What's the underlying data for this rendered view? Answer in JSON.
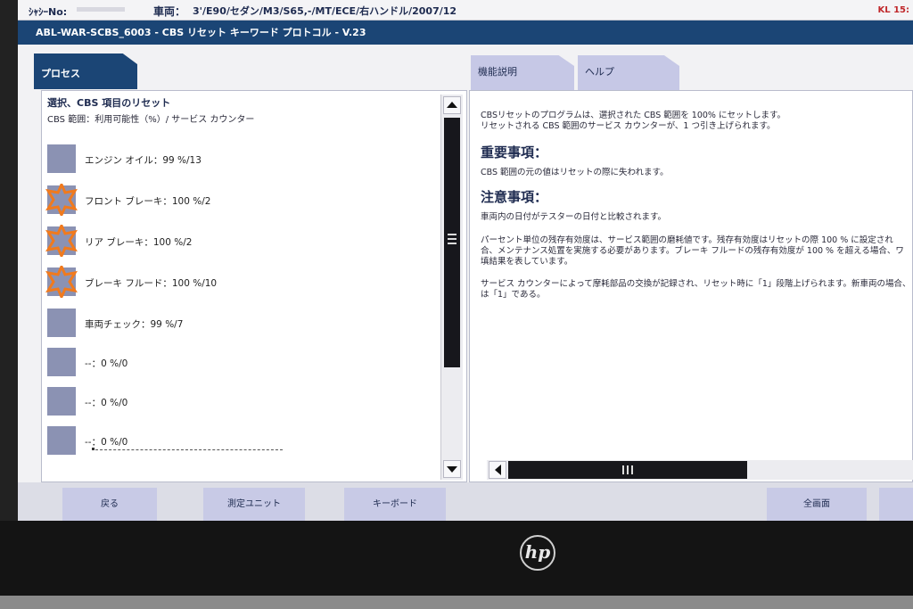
{
  "topbar": {
    "vin_label": "ｼｬｼｰNo:",
    "vehicle_label": "車両：",
    "vehicle_value": "3'/E90/セダン/M3/S65,-/MT/ECE/右ハンドル/2007/12",
    "terminal": "KL 15:"
  },
  "title": "ABL-WAR-SCBS_6003 - CBS リセット キーワード プロトコル - V.23",
  "tabs": {
    "process": "プロセス",
    "function": "機能説明",
    "help": "ヘルプ"
  },
  "left": {
    "heading": "選択、CBS 項目のリセット",
    "subheading": "CBS 範囲：利用可能性（%）/ サービス カウンター",
    "items": [
      {
        "label": "エンジン オイル：99 %/13",
        "icon": "blue-square"
      },
      {
        "label": "フロント ブレーキ：100 %/2",
        "icon": "orange-star"
      },
      {
        "label": "リア ブレーキ：100 %/2",
        "icon": "orange-star"
      },
      {
        "label": "ブレーキ フルード：100 %/10",
        "icon": "orange-star"
      },
      {
        "label": "車両チェック：99 %/7",
        "icon": "blue-square"
      },
      {
        "label": "--：0 %/0",
        "icon": "blue-square"
      },
      {
        "label": "--：0 %/0",
        "icon": "blue-square"
      },
      {
        "label": "--：0 %/0",
        "icon": "blue-square"
      }
    ]
  },
  "right": {
    "intro_1": "CBSリセットのプログラムは、選択された CBS 範囲を 100% にセットします。",
    "intro_2": "リセットされる CBS 範囲のサービス カウンターが、1 つ引き上げられます。",
    "important_heading": "重要事項：",
    "important_text": "CBS 範囲の元の値はリセットの際に失われます。",
    "note_heading": "注意事項：",
    "note_1": "車両内の日付がテスターの日付と比較されます。",
    "note_2a": "パーセント単位の残存有効度は、サービス範囲の磨耗値です。残存有効度はリセットの際 100 % に設定され",
    "note_2b": "合、メンテナンス処置を実施する必要があります。ブレーキ フルードの残存有効度が 100 % を超える場合、ワ",
    "note_2c": "填結果を表しています。",
    "note_3a": "サービス カウンターによって摩耗部品の交換が記録され、リセット時に「1」段階上げられます。新車両の場合、",
    "note_3b": "は「1」である。"
  },
  "buttons": {
    "back": "戻る",
    "measure": "測定ユニット",
    "keyboard": "キーボード",
    "fullscreen": "全画面"
  },
  "colors": {
    "accent": "#1b4575",
    "tab_inactive": "#c6c8e6",
    "item_square": "#8b92b3",
    "star_outline": "#f07a1e",
    "warning_text": "#c0282b"
  },
  "laptop_brand": "hp"
}
